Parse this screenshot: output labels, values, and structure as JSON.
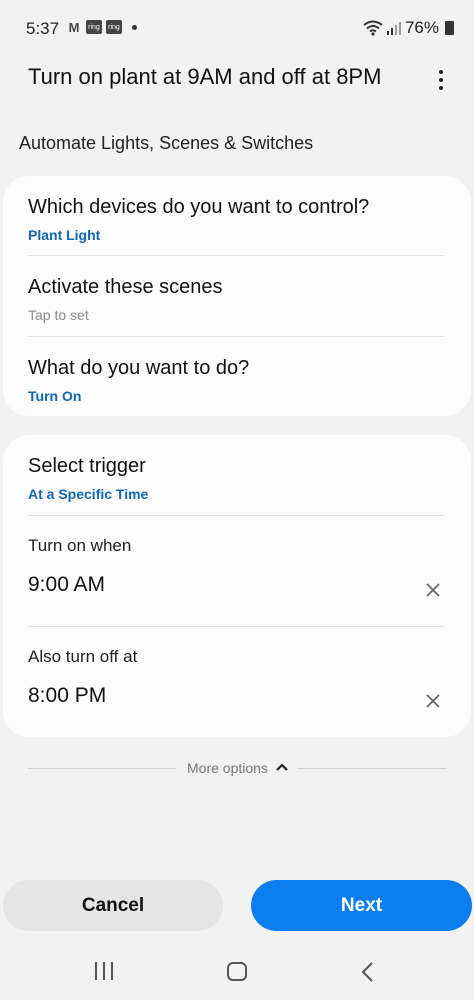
{
  "status_bar": {
    "time": "5:37",
    "left_icons": [
      "gmail-icon",
      "ring-icon",
      "ring-icon"
    ],
    "ring_label": "ring",
    "gmail_label": "M",
    "battery": "76%"
  },
  "header": {
    "title": "Turn on plant at 9AM and off at 8PM",
    "menu_icon": "more-vert-icon"
  },
  "section_title": "Automate Lights, Scenes & Switches",
  "card1": {
    "devices": {
      "title": "Which devices do you want to control?",
      "value": "Plant Light"
    },
    "scenes": {
      "title": "Activate these scenes",
      "value": "Tap to set"
    },
    "action": {
      "title": "What do you want to do?",
      "value": "Turn On"
    }
  },
  "card2": {
    "trigger": {
      "title": "Select trigger",
      "value": "At a Specific Time"
    },
    "turn_on": {
      "label": "Turn on when",
      "time": "9:00 AM"
    },
    "turn_off": {
      "label": "Also turn off at",
      "time": "8:00 PM"
    }
  },
  "more_options": {
    "label": "More options",
    "icon": "chevron-up-icon"
  },
  "buttons": {
    "cancel": "Cancel",
    "next": "Next"
  },
  "colors": {
    "accent_blue": "#1168b0",
    "primary_button": "#0c7ef0",
    "background": "#f2f2f2",
    "card": "#fcfcfc"
  },
  "nav_icons": [
    "recents-icon",
    "home-icon",
    "back-icon"
  ]
}
